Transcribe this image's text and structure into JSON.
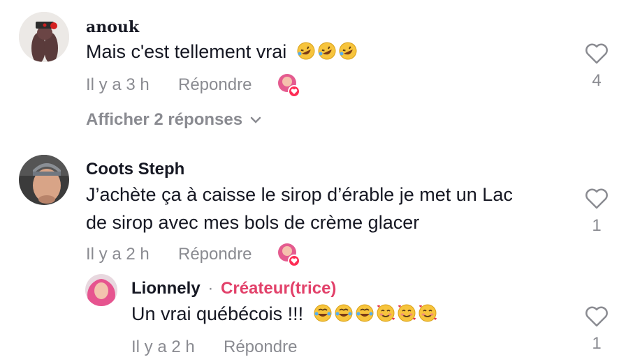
{
  "comments": [
    {
      "author": "anouk",
      "text": "Mais c'est tellement vrai",
      "emoji": [
        "rofl-emoji",
        "rofl-emoji",
        "rofl-emoji"
      ],
      "time": "Il y a 3 h",
      "reply_label": "Répondre",
      "likes": "4",
      "view_replies": "Afficher 2 réponses"
    },
    {
      "author": "Coots Steph",
      "text_line1": "J’achète ça à caisse le sirop d’érable je met un Lac",
      "text_line2": "de sirop avec mes bols de crème glacer",
      "time": "Il y a 2 h",
      "reply_label": "Répondre",
      "likes": "1",
      "replies": [
        {
          "author": "Lionnely",
          "separator": "·",
          "badge": "Créateur(trice)",
          "text": "Un vrai québécois !!!",
          "emoji": [
            "joy-emoji",
            "joy-emoji",
            "joy-emoji",
            "smiling-hearts-emoji",
            "smiling-hearts-emoji",
            "smiling-hearts-emoji"
          ],
          "time": "Il y a 2 h",
          "reply_label": "Répondre",
          "likes": "1"
        }
      ]
    }
  ],
  "colors": {
    "text": "#161823",
    "muted": "#8a8b91",
    "creator_badge": "#e2416a",
    "liked_by_creator": "#fe2c55"
  }
}
